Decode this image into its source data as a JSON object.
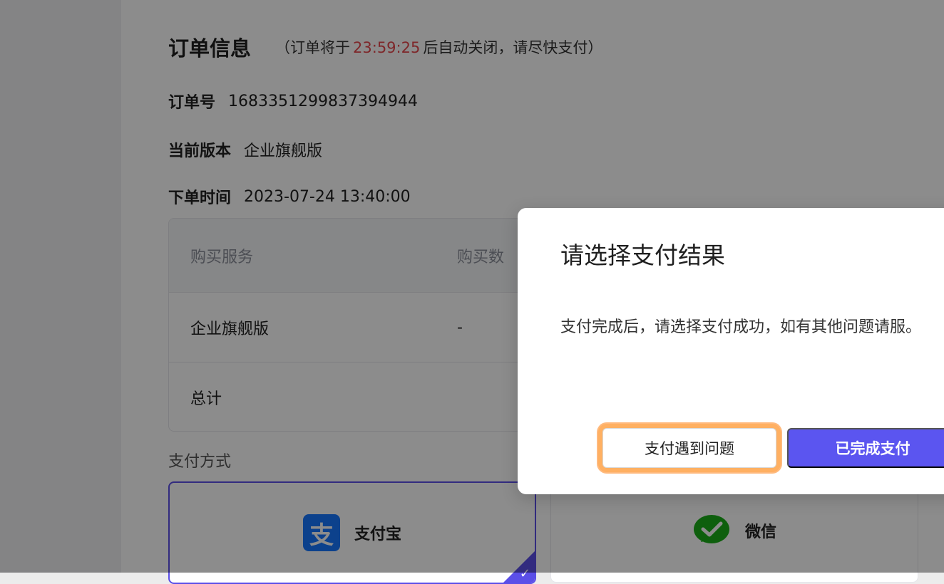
{
  "order": {
    "title": "订单信息",
    "note_prefix": "（订单将于",
    "countdown": "23:59:25",
    "note_suffix": "后自动关闭，请尽快支付）",
    "fields": [
      {
        "label": "订单号",
        "value": "1683351299837394944"
      },
      {
        "label": "当前版本",
        "value": "企业旗舰版"
      },
      {
        "label": "下单时间",
        "value": "2023-07-24 13:40:00"
      }
    ]
  },
  "table": {
    "headers": [
      "购买服务",
      "购买数"
    ],
    "rows": [
      [
        "企业旗舰版",
        "-"
      ],
      [
        "总计",
        ""
      ]
    ]
  },
  "payment": {
    "label": "支付方式",
    "methods": [
      {
        "name": "支付宝",
        "icon": "alipay-icon",
        "selected": true
      },
      {
        "name": "微信",
        "icon": "wechat-icon",
        "selected": false
      }
    ]
  },
  "modal": {
    "title": "请选择支付结果",
    "body": "支付完成后，请选择支付成功，如有其他问题请服。",
    "secondary_button": "支付遇到问题",
    "primary_button": "已完成支付"
  },
  "colors": {
    "countdown": "#e5484d",
    "accent": "#5b55f0",
    "focus_ring": "#ff9a3c"
  }
}
